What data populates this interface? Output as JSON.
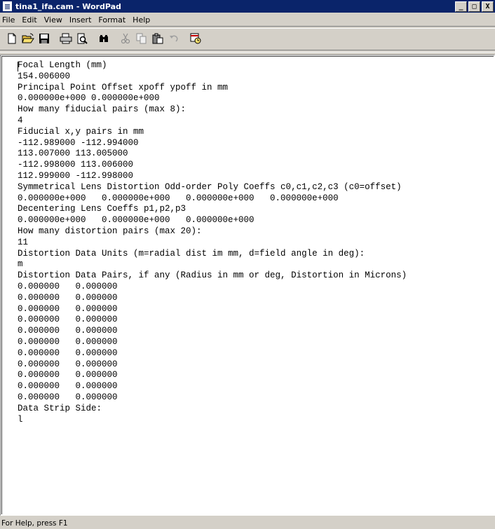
{
  "window": {
    "title": "tina1_ifa.cam - WordPad",
    "minimize_glyph": "_",
    "maximize_glyph": "□",
    "close_glyph": "X"
  },
  "menu": {
    "items": [
      "File",
      "Edit",
      "View",
      "Insert",
      "Format",
      "Help"
    ]
  },
  "toolbar": {
    "icons": [
      "new-icon",
      "open-icon",
      "save-icon",
      "print-icon",
      "print-preview-icon",
      "find-icon",
      "cut-icon",
      "copy-icon",
      "paste-icon",
      "undo-icon",
      "date-time-icon"
    ]
  },
  "document": {
    "lines": [
      "Focal Length (mm)",
      "154.006000",
      "Principal Point Offset xpoff ypoff in mm",
      "0.000000e+000 0.000000e+000",
      "How many fiducial pairs (max 8):",
      "4",
      "Fiducial x,y pairs in mm",
      "-112.989000 -112.994000",
      "113.007000 113.005000",
      "-112.998000 113.006000",
      "112.999000 -112.998000",
      "Symmetrical Lens Distortion Odd-order Poly Coeffs c0,c1,c2,c3 (c0=offset)",
      "0.000000e+000   0.000000e+000   0.000000e+000   0.000000e+000",
      "Decentering Lens Coeffs p1,p2,p3",
      "0.000000e+000   0.000000e+000   0.000000e+000",
      "How many distortion pairs (max 20):",
      "11",
      "Distortion Data Units (m=radial dist im mm, d=field angle in deg):",
      "m",
      "Distortion Data Pairs, if any (Radius in mm or deg, Distortion in Microns)",
      "0.000000   0.000000",
      "0.000000   0.000000",
      "0.000000   0.000000",
      "0.000000   0.000000",
      "0.000000   0.000000",
      "0.000000   0.000000",
      "0.000000   0.000000",
      "0.000000   0.000000",
      "0.000000   0.000000",
      "0.000000   0.000000",
      "0.000000   0.000000",
      "Data Strip Side:",
      "l"
    ]
  },
  "status": {
    "text": "For Help, press F1"
  },
  "colors": {
    "titlebar": "#0a246a",
    "chrome": "#d4d0c8",
    "document_bg": "#ffffff"
  }
}
